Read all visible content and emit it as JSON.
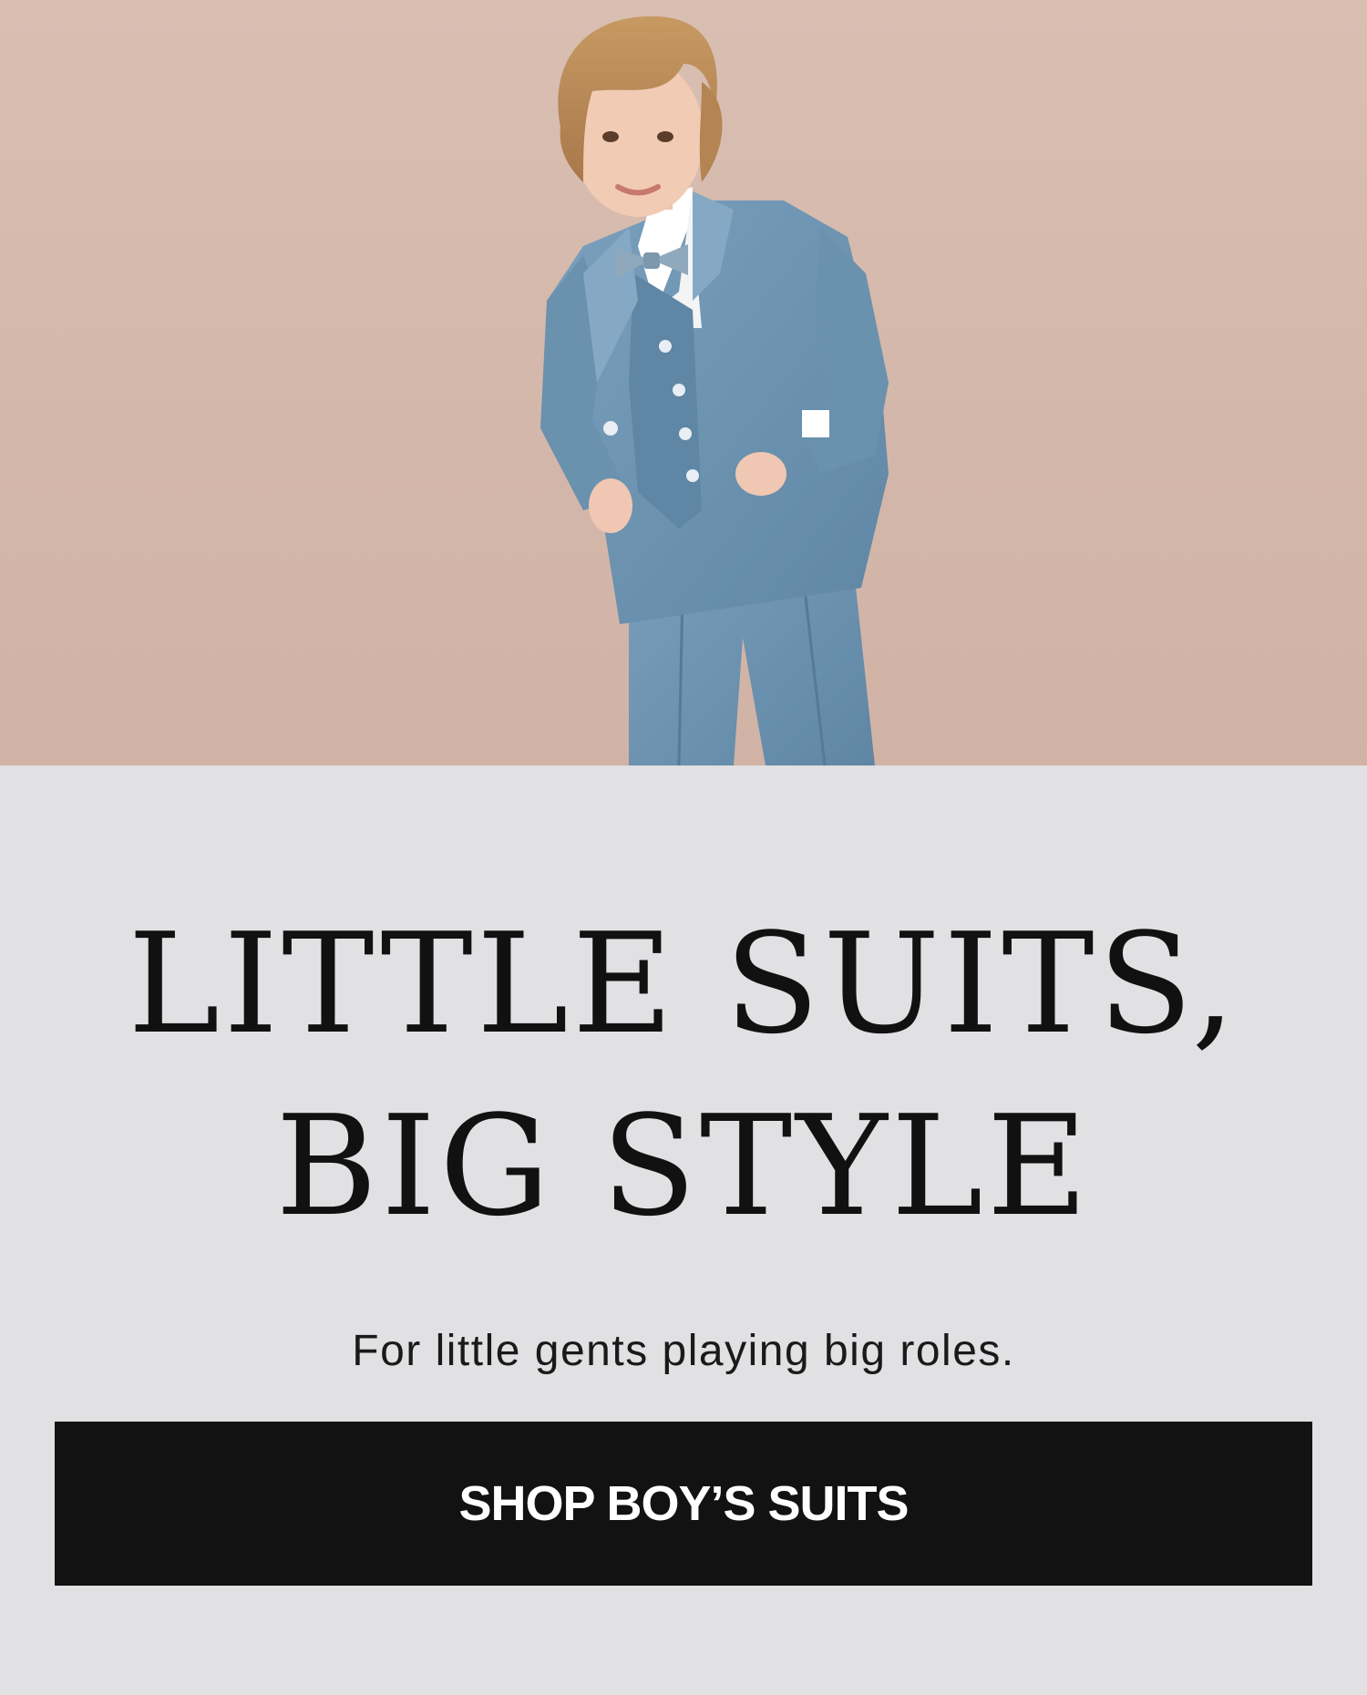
{
  "hero": {
    "image_alt": "Boy wearing a light blue three-piece suit with bow tie",
    "background_color": "#d6bbae",
    "suit_color": "#6f96b3"
  },
  "headline": {
    "line1": "LITTLE SUITS,",
    "line2": "BIG STYLE"
  },
  "subheadline": "For little gents playing big roles.",
  "cta": {
    "label": "SHOP BOY’S SUITS",
    "background": "#121212",
    "text_color": "#ffffff"
  },
  "page_background": "#e1e1e3"
}
